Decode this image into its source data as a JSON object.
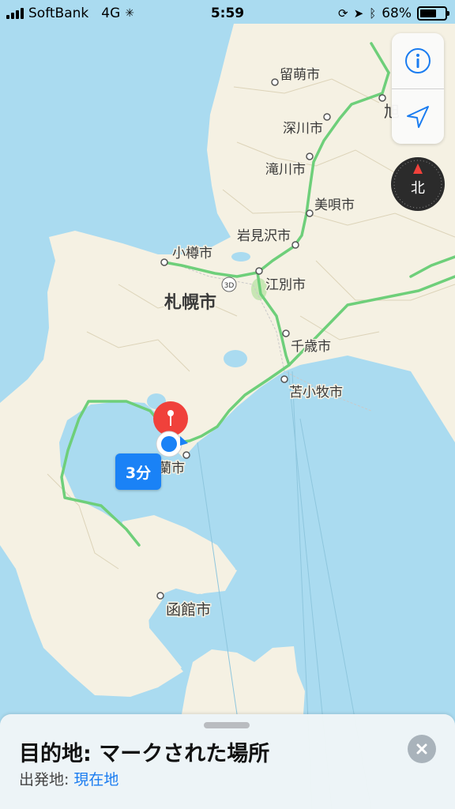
{
  "status_bar": {
    "carrier": "SoftBank",
    "network": "4G",
    "time": "5:59",
    "battery": "68%",
    "battery_level": 0.68,
    "icons": [
      "signal-bars-icon",
      "loading-spinner-icon",
      "rotation-lock-icon",
      "location-arrow-icon",
      "bluetooth-icon",
      "battery-icon"
    ]
  },
  "map": {
    "cities": {
      "rumoi": "留萌市",
      "fukagawa": "深川市",
      "takikawa": "滝川市",
      "bibai": "美唄市",
      "iwamizawa": "岩見沢市",
      "otaru": "小樽市",
      "ebetsu": "江別市",
      "sapporo": "札幌市",
      "chitose": "千歳市",
      "tomakomai": "苫小牧市",
      "muroran": "蘭市",
      "hakodate": "函館市",
      "asahikawa_partial": "旭"
    },
    "route_shield": "3D",
    "colors": {
      "water": "#aadbf0",
      "land": "#f5f1e3",
      "highway": "#6ecf7a",
      "pin": "#f0413b",
      "user_location": "#1a82f6"
    }
  },
  "controls": {
    "info_icon": "info-icon",
    "tracking_icon": "location-tracking-icon",
    "compass_label": "北"
  },
  "route": {
    "eta": "3分"
  },
  "sheet": {
    "destination": "目的地: マークされた場所",
    "origin_label": "出発地:",
    "origin_value": "現在地"
  }
}
